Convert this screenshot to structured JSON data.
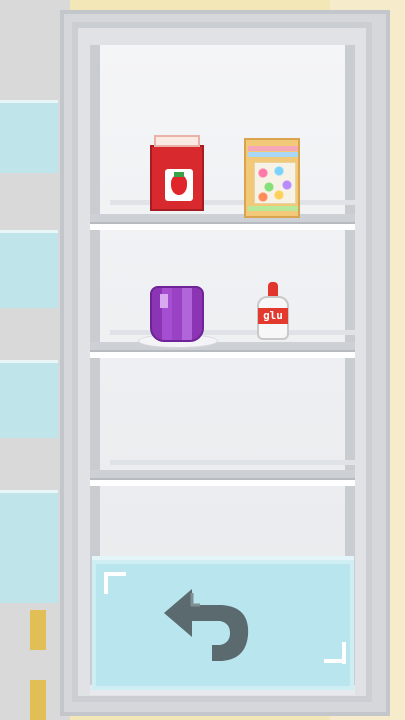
{
  "scene": {
    "title": "",
    "colors": {
      "fridge_body": "#d5d7da",
      "shelf": "#cdd1d6",
      "crisper": "#b9e6ee",
      "arrow": "#5a6a6e"
    }
  },
  "items": {
    "jam": {
      "icon": "strawberry-jam-jar"
    },
    "candy": {
      "icon": "candy-bag"
    },
    "jelly": {
      "icon": "purple-jelly-on-plate"
    },
    "glue": {
      "icon": "glue-bottle",
      "label": "glu"
    }
  },
  "navigation": {
    "back": {
      "icon": "back-arrow"
    }
  }
}
